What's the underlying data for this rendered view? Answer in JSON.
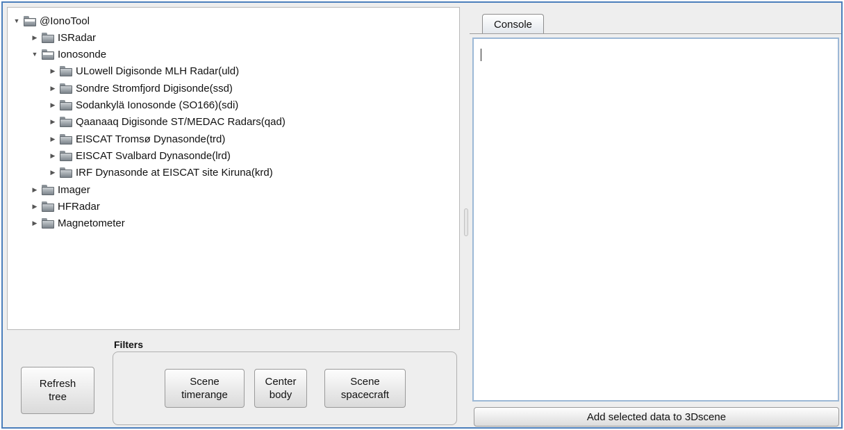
{
  "tree": {
    "nodes": [
      {
        "label": "@IonoTool",
        "expanded": true,
        "depth": 0,
        "icon": "folder-icon"
      },
      {
        "label": "ISRadar",
        "expanded": false,
        "depth": 1,
        "icon": "folder-icon"
      },
      {
        "label": "Ionosonde",
        "expanded": true,
        "depth": 1,
        "icon": "folder-icon"
      },
      {
        "label": "ULowell Digisonde MLH Radar(uld)",
        "expanded": false,
        "depth": 2,
        "icon": "folder-icon"
      },
      {
        "label": "Sondre Stromfjord Digisonde(ssd)",
        "expanded": false,
        "depth": 2,
        "icon": "folder-icon"
      },
      {
        "label": "Sodankylä Ionosonde (SO166)(sdi)",
        "expanded": false,
        "depth": 2,
        "icon": "folder-icon"
      },
      {
        "label": "Qaanaaq Digisonde ST/MEDAC Radars(qad)",
        "expanded": false,
        "depth": 2,
        "icon": "folder-icon"
      },
      {
        "label": "EISCAT Tromsø Dynasonde(trd)",
        "expanded": false,
        "depth": 2,
        "icon": "folder-icon"
      },
      {
        "label": "EISCAT Svalbard Dynasonde(lrd)",
        "expanded": false,
        "depth": 2,
        "icon": "folder-icon"
      },
      {
        "label": "IRF Dynasonde at EISCAT site Kiruna(krd)",
        "expanded": false,
        "depth": 2,
        "icon": "folder-icon"
      },
      {
        "label": "Imager",
        "expanded": false,
        "depth": 1,
        "icon": "folder-icon"
      },
      {
        "label": "HFRadar",
        "expanded": false,
        "depth": 1,
        "icon": "folder-icon"
      },
      {
        "label": "Magnetometer",
        "expanded": false,
        "depth": 1,
        "icon": "folder-icon"
      }
    ],
    "glyphs": {
      "expanded": "▼",
      "collapsed": "▶"
    }
  },
  "bottom": {
    "refresh_label": "Refresh\ntree",
    "filters_title": "Filters",
    "filter_buttons": [
      {
        "label": "Scene\ntimerange"
      },
      {
        "label": "Center\nbody"
      },
      {
        "label": "Scene\nspacecraft"
      }
    ]
  },
  "console": {
    "tab_label": "Console",
    "text": ""
  },
  "actions": {
    "add_label": "Add selected data to 3Dscene"
  },
  "colors": {
    "window_border": "#4a7ebb",
    "panel_bg": "#eeeeee",
    "console_border": "#9cb8d6"
  }
}
